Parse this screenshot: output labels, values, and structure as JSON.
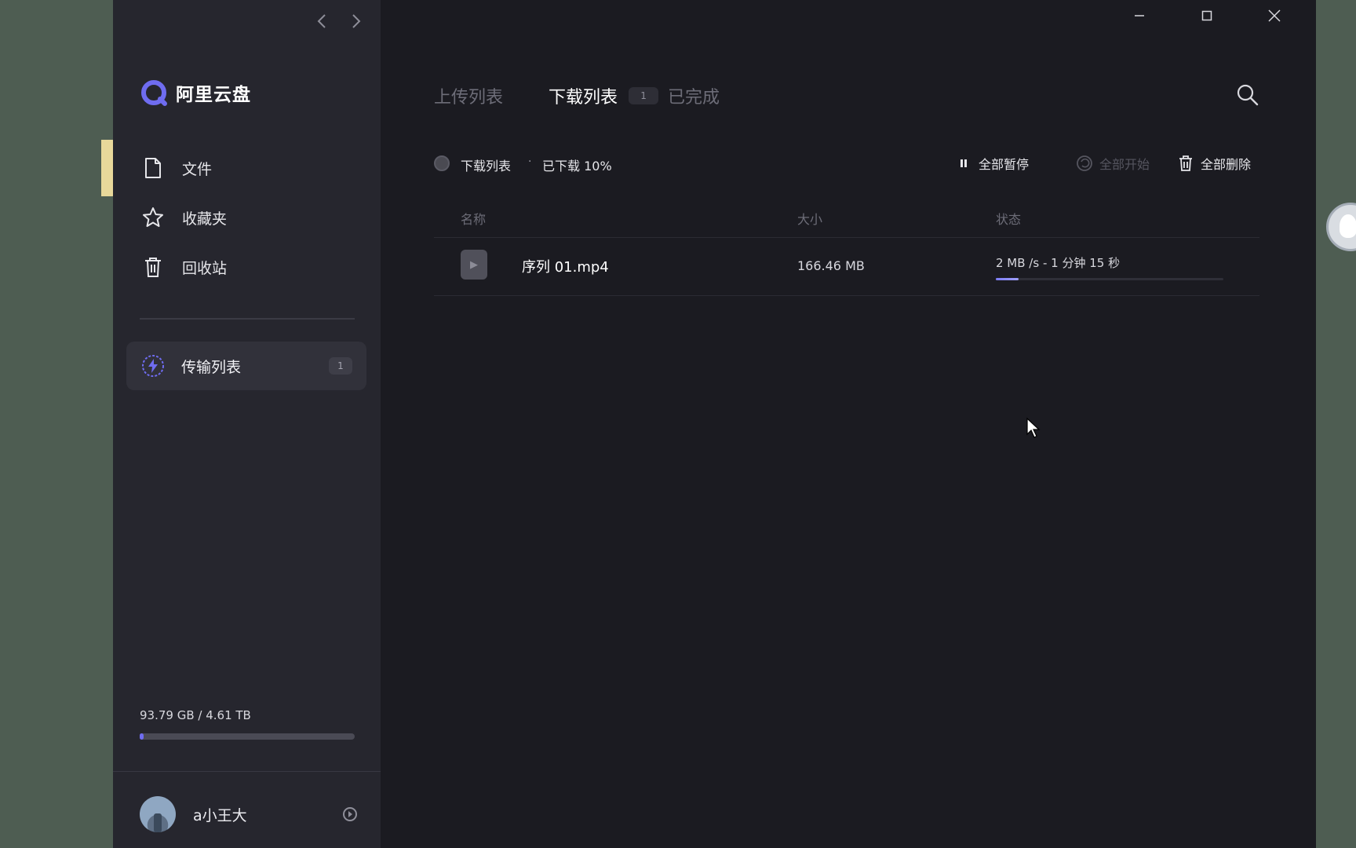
{
  "window": {
    "controls": [
      "minimize",
      "maximize",
      "close"
    ]
  },
  "sidebar": {
    "brand": "阿里云盘",
    "nav_items": [
      {
        "label": "文件",
        "icon": "file-icon"
      },
      {
        "label": "收藏夹",
        "icon": "star-icon"
      },
      {
        "label": "回收站",
        "icon": "trash-icon"
      }
    ],
    "transfer": {
      "label": "传输列表",
      "count": "1",
      "icon": "lightning-icon"
    },
    "storage": {
      "text": "93.79 GB / 4.61 TB",
      "used_fraction": 0.02
    },
    "user": {
      "name": "a小王大"
    }
  },
  "main": {
    "tabs": {
      "upload": "上传列表",
      "download": "下载列表",
      "download_count": "1",
      "done": "已完成"
    },
    "toolbar": {
      "title": "下载列表",
      "separator": "·",
      "progress_text": "已下载 10%",
      "pause_all": "全部暂停",
      "start_all": "全部开始",
      "delete_all": "全部删除"
    },
    "table": {
      "headers": {
        "name": "名称",
        "size": "大小",
        "status": "状态"
      },
      "rows": [
        {
          "name": "序列 01.mp4",
          "size": "166.46 MB",
          "status": "2 MB /s - 1 分钟 15 秒",
          "progress_fraction": 0.1
        }
      ]
    }
  },
  "colors": {
    "accent": "#6f6cf0",
    "window_bg": "#1b1b21",
    "sidebar_bg": "#26262e"
  }
}
